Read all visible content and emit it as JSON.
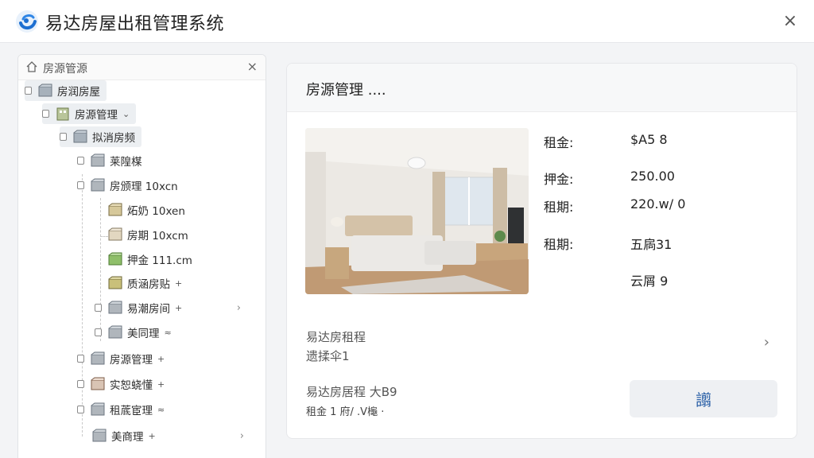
{
  "window": {
    "title": "易达房屋出租管理系统",
    "close_icon": "×"
  },
  "tree": {
    "header_label": "房源管源",
    "close_icon": "×",
    "nodes": [
      {
        "label": "房润房屋",
        "suffix": ""
      },
      {
        "label": "房源管理",
        "suffix": "⌄"
      },
      {
        "label": "拟消房频",
        "suffix": ""
      },
      {
        "label": "莱隍楳",
        "suffix": ""
      },
      {
        "label": "房颁理 10xcn",
        "suffix": ""
      },
      {
        "label": "炻奶 10xen",
        "suffix": ""
      },
      {
        "label": "房期 10xcm",
        "suffix": ""
      },
      {
        "label": "押金 111.cm",
        "suffix": ""
      },
      {
        "label": "质涵房贴",
        "suffix": "+"
      },
      {
        "label": "易潮房间",
        "suffix": "+"
      },
      {
        "label": "美同理",
        "suffix": "≈"
      },
      {
        "label": "房源管理",
        "suffix": "+"
      },
      {
        "label": "实恕蛲懂",
        "suffix": "+"
      },
      {
        "label": "租菧宦理",
        "suffix": "≈"
      },
      {
        "label": "美商理",
        "suffix": "+"
      }
    ]
  },
  "card": {
    "title": "房源管理 ....",
    "details": [
      {
        "label": "租金:",
        "value": "$A5 8"
      },
      {
        "label": "押金:",
        "value": "250.00"
      },
      {
        "label": "租期:",
        "value": "220.w/ 0"
      },
      {
        "label": "租期:",
        "value": "五扄31"
      },
      {
        "label": "",
        "value": "云屑 9"
      }
    ],
    "info1_line1": "易达房租程",
    "info1_line2": "遗揉伞1",
    "info2_line1": "易达房居程 大B9",
    "info2_line2": "租金 1 府/ .V櫷 ‧",
    "action_label": "譾"
  }
}
